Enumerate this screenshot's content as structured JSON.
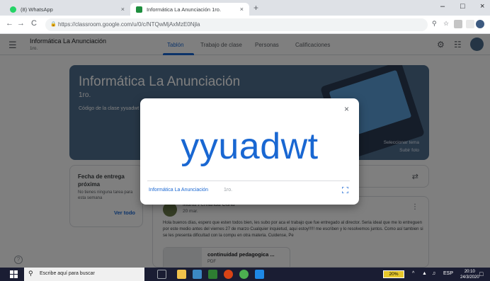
{
  "browser": {
    "tabs": [
      {
        "label": "(8) WhatsApp",
        "close": "×"
      },
      {
        "label": "Informática La Anunciación 1ro.",
        "close": "×"
      }
    ],
    "new_tab": "+",
    "window_controls": {
      "minimize": "–",
      "maximize": "□",
      "close": "×"
    },
    "url": "https://classroom.google.com/u/0/c/NTQwMjAxMzE0Njla",
    "nav": {
      "back": "←",
      "forward": "→",
      "reload": "C"
    }
  },
  "classroom": {
    "class_name": "Informática La Anunciación",
    "section": "1ro.",
    "tabs": [
      "Tablón",
      "Trabajo de clase",
      "Personas",
      "Calificaciones"
    ],
    "active_tab": "Tablón",
    "banner": {
      "title": "Informática La Anunciación",
      "section": "1ro.",
      "code_label": "Código de la clase  yyuadwt",
      "select_theme": "Seleccionar tema",
      "upload_photo": "Subir foto"
    },
    "due": {
      "title": "Fecha de entrega próxima",
      "text": "No tienes ninguna tarea para esta semana",
      "link": "Ver todo"
    },
    "post": {
      "author": "Marta Fernanda Curia",
      "date": "20 mar.",
      "body": "Hola buenos días, espero que esten todos bien, les subo por aca el trabajo que fue entregado al director. Seria ideal que me lo entreguen por este medio antes del viernes 27 de marzo Cualquier inquietud, aqui estoy!!!!! me escriben y lo resolvemos juntos. Como así tambien si se les presenta dificultad con la compu en otra materia. Cuidense, Pe",
      "attachment_title": "continuidad pedagogica ...",
      "attachment_type": "PDF"
    }
  },
  "modal": {
    "code": "yyuadwt",
    "class_name": "Informática La Anunciación",
    "section": "1ro.",
    "close": "×"
  },
  "taskbar": {
    "search_placeholder": "Escribe aquí para buscar",
    "battery": "20%",
    "lang": "ESP",
    "time": "20:10",
    "date": "24/3/2020"
  },
  "colors": {
    "accent": "#1967d2",
    "banner": "#4e6e8e",
    "taskbar": "#1a1d33"
  },
  "icons": [
    "menu-icon",
    "settings-icon",
    "apps-grid-icon",
    "close-icon",
    "fullscreen-icon",
    "share-icon",
    "more-vert-icon",
    "help-icon",
    "search-icon",
    "star-icon",
    "zoom-icon"
  ]
}
